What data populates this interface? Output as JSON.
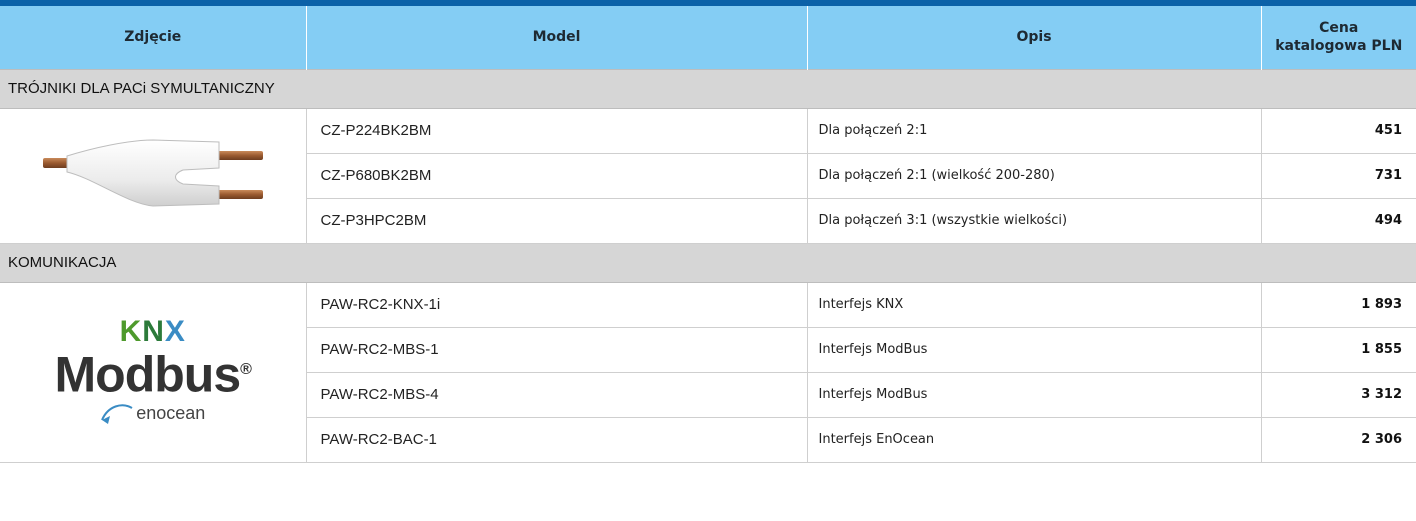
{
  "header": {
    "col_image": "Zdjęcie",
    "col_model": "Model",
    "col_desc": "Opis",
    "col_price_line1": "Cena",
    "col_price_line2": "katalogowa PLN"
  },
  "colors": {
    "top_bar": "#0b62a8",
    "header_bg": "#84cdf4",
    "section_bg": "#d6d6d6",
    "knx_green": "#4e9a2c",
    "knx_blue": "#3a8cc4"
  },
  "sections": [
    {
      "title": "TRÓJNIKI DLA PACi SYMULTANICZNY",
      "image": "y-branch-pipe-image",
      "rows": [
        {
          "model": "CZ-P224BK2BM",
          "desc": "Dla połączeń 2:1",
          "price": "451"
        },
        {
          "model": "CZ-P680BK2BM",
          "desc": "Dla połączeń 2:1 (wielkość 200-280)",
          "price": "731"
        },
        {
          "model": "CZ-P3HPC2BM",
          "desc": "Dla połączeń 3:1 (wszystkie wielkości)",
          "price": "494"
        }
      ]
    },
    {
      "title": "KOMUNIKACJA",
      "image": "knx-modbus-enocean-logos",
      "logo": {
        "knx": "KNX",
        "modbus": "Modbus",
        "reg": "®",
        "enocean": "enocean"
      },
      "rows": [
        {
          "model": "PAW-RC2-KNX-1i",
          "desc": "Interfejs KNX",
          "price": "1 893"
        },
        {
          "model": "PAW-RC2-MBS-1",
          "desc": "Interfejs ModBus",
          "price": "1 855"
        },
        {
          "model": "PAW-RC2-MBS-4",
          "desc": "Interfejs ModBus",
          "price": "3 312"
        },
        {
          "model": "PAW-RC2-BAC-1",
          "desc": "Interfejs EnOcean",
          "price": "2 306"
        }
      ]
    }
  ]
}
